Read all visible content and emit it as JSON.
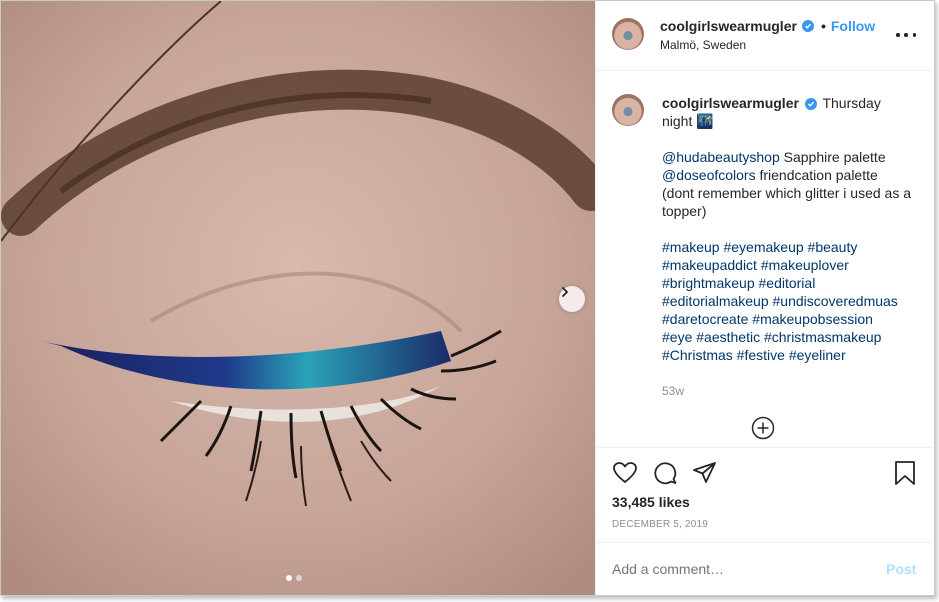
{
  "post": {
    "username": "coolgirlswearmugler",
    "follow_label": "Follow",
    "separator": "•",
    "location": "Malmö, Sweden"
  },
  "caption": {
    "username": "coolgirlswearmugler",
    "text_line1": "Thursday",
    "text_line2": "night 🌃",
    "mention1": "@hudabeautyshop",
    "mention1_text": "Sapphire palette",
    "mention2": "@doseofcolors",
    "mention2_text": "friendcation palette",
    "note": "(dont remember which glitter i used as a topper)",
    "hashtags": [
      "#makeup #eyemakeup #beauty",
      "#makeupaddict #makeuplover",
      "#brightmakeup #editorial",
      "#editorialmakeup #undiscoveredmuas",
      "#daretocreate #makeupobsession",
      "#eye #aesthetic #christmasmakeup",
      "#Christmas #festive #eyeliner"
    ],
    "age": "53w"
  },
  "actions": {
    "likes": "33,485 likes",
    "date": "DECEMBER 5, 2019"
  },
  "comment_box": {
    "placeholder": "Add a comment…",
    "post_label": "Post"
  },
  "carousel": {
    "current": 1,
    "total": 2
  },
  "icons": [
    "chevron-right-icon",
    "verified-icon",
    "more-icon",
    "load-more-icon",
    "heart-icon",
    "comment-icon",
    "share-icon",
    "bookmark-icon"
  ],
  "colors": {
    "accent": "#3897f0",
    "link": "#00376b",
    "muted": "#8e8e8e"
  }
}
